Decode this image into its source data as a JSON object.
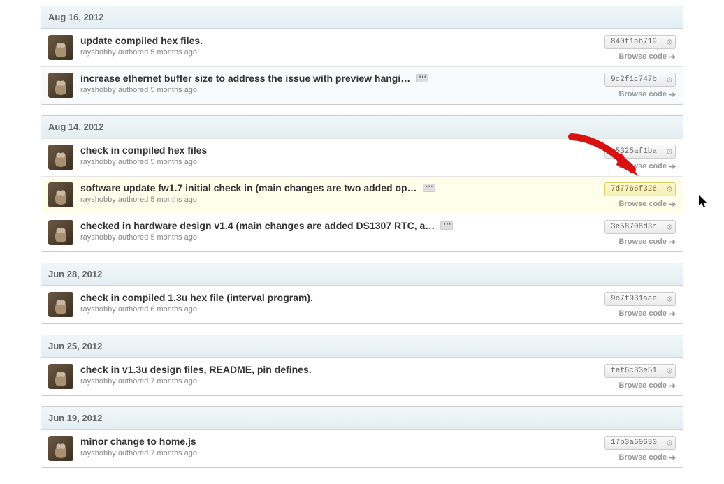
{
  "browse_code_label": "Browse code",
  "groups": [
    {
      "date": "Aug 16, 2012",
      "commits": [
        {
          "title": "update compiled hex files.",
          "author": "rayshobby",
          "time": "5 months ago",
          "sha": "840f1ab719",
          "expand": false,
          "highlighted": false,
          "alt": false
        },
        {
          "title": "increase ethernet buffer size to address the issue with preview hangi…",
          "author": "rayshobby",
          "time": "5 months ago",
          "sha": "9c2f1c747b",
          "expand": true,
          "highlighted": false,
          "alt": true
        }
      ]
    },
    {
      "date": "Aug 14, 2012",
      "commits": [
        {
          "title": "check in compiled hex files",
          "author": "rayshobby",
          "time": "5 months ago",
          "sha": "e5325af1ba",
          "expand": false,
          "highlighted": false,
          "alt": false
        },
        {
          "title": "software update fw1.7 initial check in (main changes are two added op…",
          "author": "rayshobby",
          "time": "5 months ago",
          "sha": "7d7766f326",
          "expand": true,
          "highlighted": true,
          "alt": false
        },
        {
          "title": "checked in hardware design v1.4 (main changes are added DS1307 RTC, a…",
          "author": "rayshobby",
          "time": "5 months ago",
          "sha": "3e58708d3c",
          "expand": true,
          "highlighted": false,
          "alt": false
        }
      ]
    },
    {
      "date": "Jun 28, 2012",
      "commits": [
        {
          "title": "check in compiled 1.3u hex file (interval program).",
          "author": "rayshobby",
          "time": "6 months ago",
          "sha": "9c7f931aae",
          "expand": false,
          "highlighted": false,
          "alt": false
        }
      ]
    },
    {
      "date": "Jun 25, 2012",
      "commits": [
        {
          "title": "check in v1.3u design files, README, pin defines.",
          "author": "rayshobby",
          "time": "7 months ago",
          "sha": "fef6c33e51",
          "expand": false,
          "highlighted": false,
          "alt": false
        }
      ]
    },
    {
      "date": "Jun 19, 2012",
      "commits": [
        {
          "title": "minor change to home.js",
          "author": "rayshobby",
          "time": "7 months ago",
          "sha": "17b3a60630",
          "expand": false,
          "highlighted": false,
          "alt": false
        }
      ]
    }
  ]
}
